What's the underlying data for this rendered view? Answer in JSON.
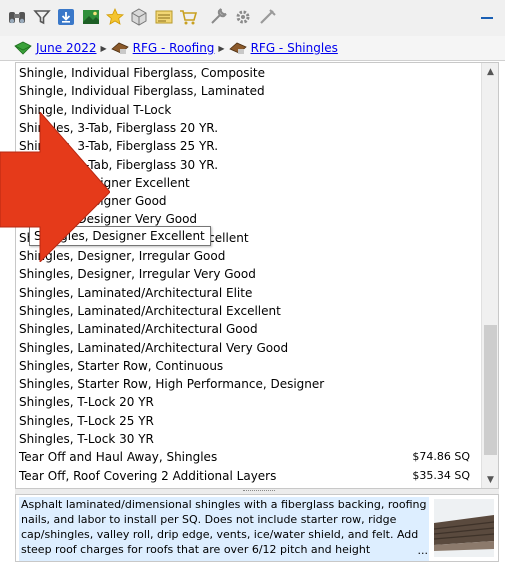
{
  "toolbar": {
    "icons": [
      "binoculars-icon",
      "filter-icon",
      "download-icon",
      "image-icon",
      "star-icon",
      "cube-icon",
      "list-icon",
      "cart-icon",
      "tools-icon",
      "gear-icon",
      "check-icon"
    ],
    "colors": {
      "accent": "#1a5fb4",
      "red_arrow": "#e53a1a",
      "link": "#0000ee",
      "scroll_thumb": "#cdcdcd"
    }
  },
  "breadcrumb": {
    "items": [
      {
        "label": "June 2022",
        "icon": "price-list-icon"
      },
      {
        "label": "RFG - Roofing",
        "icon": "roof-icon"
      },
      {
        "label": "RFG - Shingles",
        "icon": "roof-icon"
      }
    ]
  },
  "list": {
    "rows": [
      {
        "label": "Shingle, Individual Fiberglass, Composite",
        "price": ""
      },
      {
        "label": "Shingle, Individual Fiberglass, Laminated",
        "price": ""
      },
      {
        "label": "Shingle, Individual T-Lock",
        "price": ""
      },
      {
        "label": "Shingles, 3-Tab, Fiberglass 20 YR.",
        "price": ""
      },
      {
        "label": "Shingles, 3-Tab, Fiberglass 25 YR.",
        "price": ""
      },
      {
        "label": "Shingles, 3-Tab, Fiberglass 30 YR.",
        "price": ""
      },
      {
        "label": "Shingles, Designer Excellent",
        "price": ""
      },
      {
        "label": "Shingles, Designer Good",
        "price": ""
      },
      {
        "label": "Shingles, Designer Very Good",
        "price": ""
      },
      {
        "label": "Shingles, Designer, Irregular Excellent",
        "price": ""
      },
      {
        "label": "Shingles, Designer, Irregular Good",
        "price": ""
      },
      {
        "label": "Shingles, Designer, Irregular Very Good",
        "price": ""
      },
      {
        "label": "Shingles, Laminated/Architectural Elite",
        "price": ""
      },
      {
        "label": "Shingles, Laminated/Architectural Excellent",
        "price": ""
      },
      {
        "label": "Shingles, Laminated/Architectural Good",
        "price": ""
      },
      {
        "label": "Shingles, Laminated/Architectural Very Good",
        "price": ""
      },
      {
        "label": "Shingles, Starter Row, Continuous",
        "price": ""
      },
      {
        "label": "Shingles, Starter Row, High Performance, Designer",
        "price": ""
      },
      {
        "label": "Shingles, T-Lock 20 YR",
        "price": ""
      },
      {
        "label": "Shingles, T-Lock 25 YR",
        "price": ""
      },
      {
        "label": "Shingles, T-Lock 30 YR",
        "price": ""
      },
      {
        "label": "Tear Off and Haul Away, Shingles",
        "price": "$74.86 SQ"
      },
      {
        "label": "Tear Off, Roof Covering 2 Additional Layers",
        "price": "$35.34 SQ"
      }
    ]
  },
  "tooltip": {
    "text": "Shingles, Designer Excellent"
  },
  "description": {
    "text": "Asphalt laminated/dimensional shingles with a fiberglass backing, roofing nails, and labor to install per SQ.  Does not include starter row, ridge cap/shingles, valley roll, drip edge, vents, ice/water shield, and felt.  Add steep roof charges for roofs that are over 6/12 pitch and height",
    "more": "...",
    "image": "shingle-roof-thumbnail"
  }
}
